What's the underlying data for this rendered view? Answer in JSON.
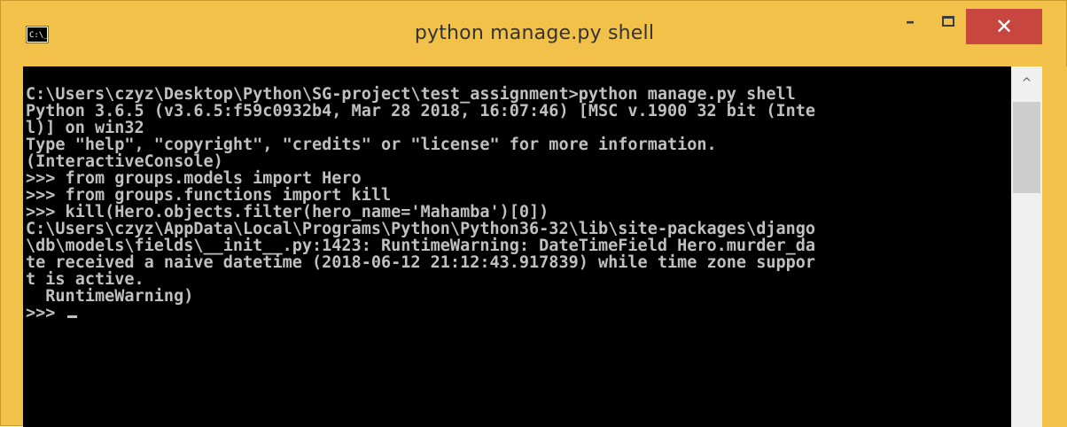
{
  "window": {
    "title": "python  manage.py shell",
    "app_icon": "cmd-icon",
    "app_icon_text": "C:\\_",
    "accent": "#f2c14a",
    "close_color": "#c7463d"
  },
  "controls": {
    "minimize_icon": "minimize-icon",
    "minimize_glyph": "–",
    "maximize_icon": "maximize-icon",
    "close_icon": "close-icon",
    "close_glyph": "✕"
  },
  "console": {
    "lines": [
      "C:\\Users\\czyz\\Desktop\\Python\\SG-project\\test_assignment>python manage.py shell",
      "Python 3.6.5 (v3.6.5:f59c0932b4, Mar 28 2018, 16:07:46) [MSC v.1900 32 bit (Inte",
      "l)] on win32",
      "Type \"help\", \"copyright\", \"credits\" or \"license\" for more information.",
      "(InteractiveConsole)",
      ">>> from groups.models import Hero",
      ">>> from groups.functions import kill",
      ">>> kill(Hero.objects.filter(hero_name='Mahamba')[0])",
      "C:\\Users\\czyz\\AppData\\Local\\Programs\\Python\\Python36-32\\lib\\site-packages\\django",
      "\\db\\models\\fields\\__init__.py:1423: RuntimeWarning: DateTimeField Hero.murder_da",
      "te received a naive datetime (2018-06-12 21:12:43.917839) while time zone suppor",
      "t is active.",
      "  RuntimeWarning)"
    ],
    "prompt": ">>> "
  },
  "scrollbar": {
    "up_icon": "scroll-up-arrow-icon",
    "up_glyph": "^"
  }
}
